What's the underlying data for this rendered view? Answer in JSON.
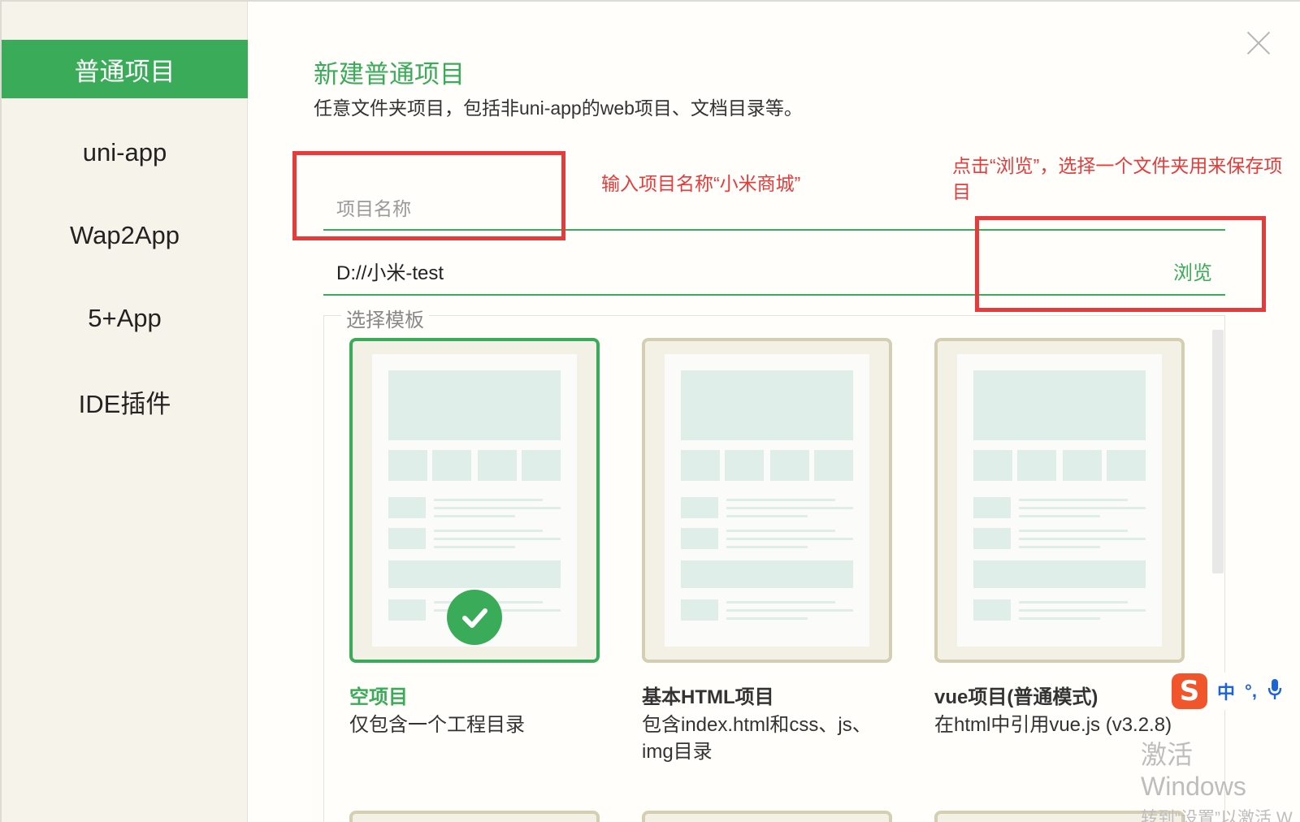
{
  "sidebar": {
    "items": [
      {
        "label": "普通项目",
        "active": true
      },
      {
        "label": "uni-app",
        "active": false
      },
      {
        "label": "Wap2App",
        "active": false
      },
      {
        "label": "5+App",
        "active": false
      },
      {
        "label": "IDE插件",
        "active": false
      }
    ]
  },
  "header": {
    "title": "新建普通项目",
    "subtitle": "任意文件夹项目，包括非uni-app的web项目、文档目录等。"
  },
  "form": {
    "name_placeholder": "项目名称",
    "name_value": "",
    "path_value": "D://小米-test",
    "browse_label": "浏览",
    "template_legend": "选择模板"
  },
  "annotations": {
    "name_hint": "输入项目名称“小米商城”",
    "browse_hint": "点击“浏览”，选择一个文件夹用来保存项目"
  },
  "templates": [
    {
      "title": "空项目",
      "desc": "仅包含一个工程目录",
      "selected": true
    },
    {
      "title": "基本HTML项目",
      "desc": "包含index.html和css、js、img目录",
      "selected": false
    },
    {
      "title": "vue项目(普通模式)",
      "desc": "在html中引用vue.js (v3.2.8)",
      "selected": false
    }
  ],
  "ime": {
    "logo": "S",
    "mode": "中",
    "punct": "°,",
    "mic_icon": "microphone-icon"
  },
  "watermark": {
    "line1": "激活 Windows",
    "line2": "转到“设置”以激活 W"
  },
  "colors": {
    "accent": "#3aab59",
    "annotation": "#e63b3b",
    "card_border": "#d4cfb2",
    "sidebar_bg": "#f6f4ea"
  }
}
